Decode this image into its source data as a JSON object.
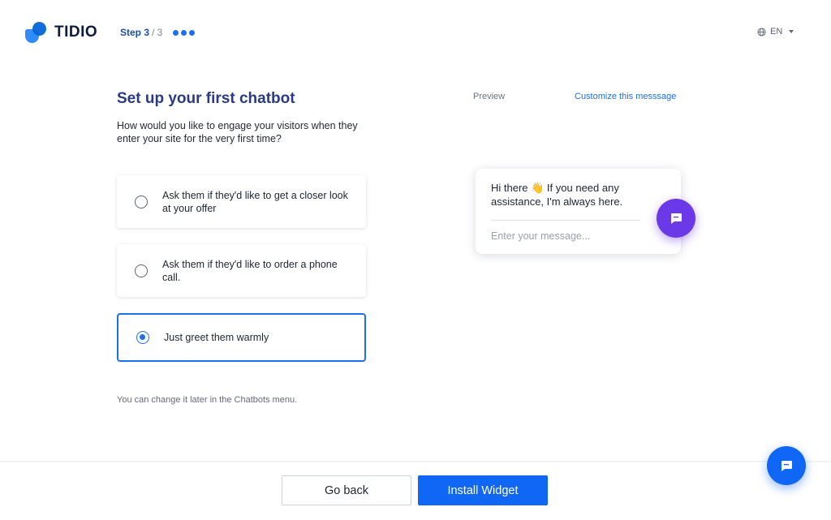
{
  "brand": {
    "name": "TIDIO",
    "primary_color": "#1167f5",
    "accent_color": "#6b39e8"
  },
  "header": {
    "step_current": "Step 3",
    "step_total": "/ 3",
    "language": "EN",
    "language_icon": "globe-icon"
  },
  "main": {
    "title": "Set up your first chatbot",
    "question": "How would you like to engage your visitors when they enter your site for the very first time?",
    "options": [
      {
        "label": "Ask them if they'd like to get a closer look at your offer",
        "selected": false
      },
      {
        "label": "Ask them if they'd like to order a phone call.",
        "selected": false
      },
      {
        "label": "Just greet them warmly",
        "selected": true
      }
    ],
    "hint": "You can change it later in the Chatbots menu."
  },
  "preview": {
    "label": "Preview",
    "customize_link": "Customize this messsage",
    "message": "Hi there 👋 If you need any assistance, I'm always here.",
    "input_placeholder": "Enter your message..."
  },
  "footer": {
    "back_label": "Go back",
    "install_label": "Install Widget"
  }
}
